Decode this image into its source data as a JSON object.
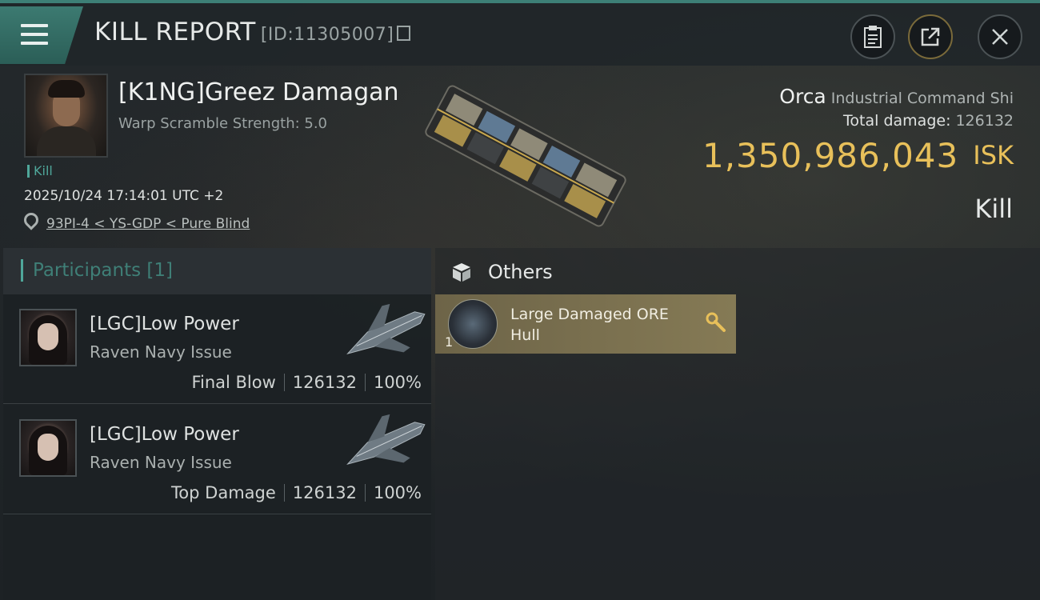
{
  "header": {
    "title": "KILL REPORT",
    "report_id": "[ID:11305007]",
    "icons": [
      "menu-icon",
      "copy-icon",
      "clipboard-icon",
      "share-icon",
      "close-icon"
    ]
  },
  "victim": {
    "name": "[K1NG]Greez Damagan",
    "warp_scramble": "Warp Scramble Strength: 5.0",
    "tag": "Kill",
    "datetime": "2025/10/24 17:14:01 UTC +2",
    "location": "93PI-4 < YS-GDP < Pure Blind",
    "ship_name": "Orca",
    "ship_class": "Industrial Command Shi",
    "total_damage_label": "Total damage:",
    "total_damage": "126132",
    "isk_value": "1,350,986,043",
    "isk_unit": "ISK",
    "result": "Kill"
  },
  "participants": {
    "title": "Participants",
    "count": "[1]",
    "rows": [
      {
        "name": "[LGC]Low Power",
        "ship": "Raven Navy Issue",
        "role": "Final Blow",
        "damage": "126132",
        "percent": "100%"
      },
      {
        "name": "[LGC]Low Power",
        "ship": "Raven Navy Issue",
        "role": "Top Damage",
        "damage": "126132",
        "percent": "100%"
      }
    ]
  },
  "others": {
    "title": "Others",
    "items": [
      {
        "qty": "1",
        "name": "Large Damaged ORE Hull"
      }
    ]
  },
  "colors": {
    "accent": "#3d7f76",
    "isk": "#e8c05a",
    "item_bg": "#7a7050"
  }
}
